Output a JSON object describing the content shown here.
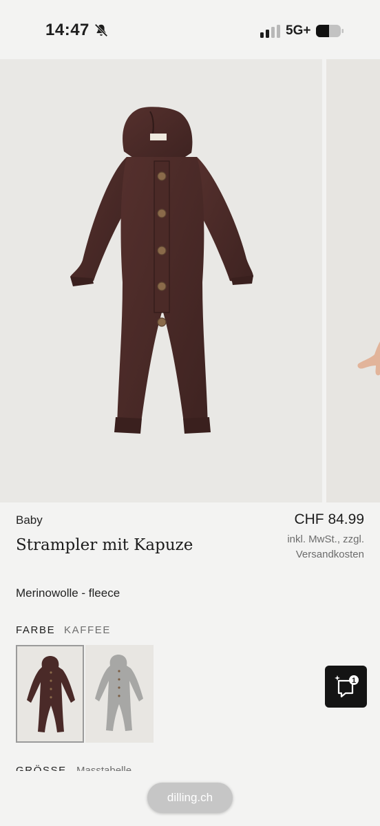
{
  "status_bar": {
    "time": "14:47",
    "network": "5G+",
    "icons": [
      "bell-slash-icon",
      "signal-icon",
      "battery-icon"
    ]
  },
  "gallery": {
    "images": [
      "romper-front",
      "romper-worn"
    ],
    "product_color": "#4a2a28"
  },
  "product": {
    "category": "Baby",
    "title": "Strampler mit Kapuze",
    "material": "Merinowolle - fleece",
    "price": "CHF 84.99",
    "price_note": "inkl. MwSt., zzgl. Versandkosten"
  },
  "color": {
    "label": "FARBE",
    "selected": "KAFFEE",
    "swatches": [
      {
        "color": "#4a2a28",
        "selected": true
      },
      {
        "color": "#a7a7a5",
        "selected": false
      }
    ]
  },
  "size": {
    "label": "GRÖSSE",
    "link": "Masstabelle"
  },
  "chat": {
    "badge": "1",
    "icon": "chat-icon"
  },
  "browser": {
    "url": "dilling.ch"
  }
}
